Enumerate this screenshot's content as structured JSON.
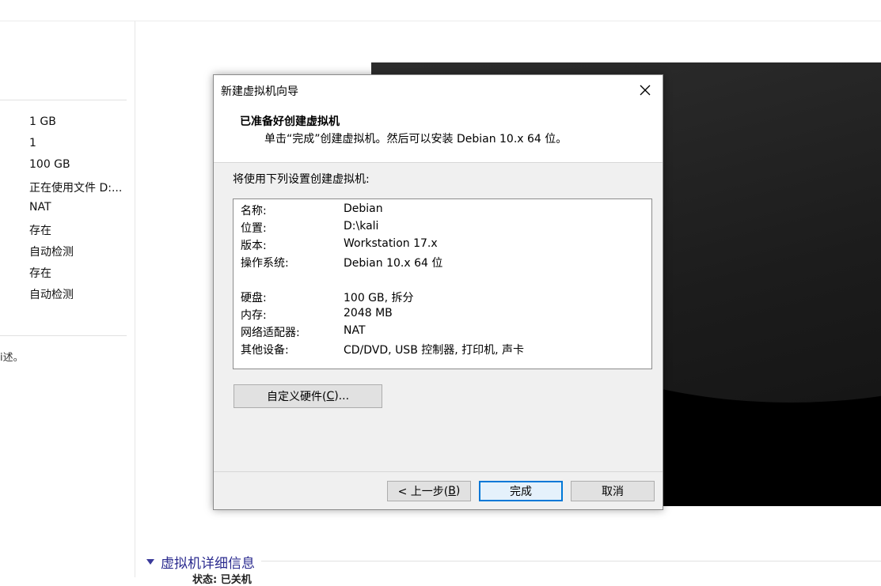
{
  "left_panel": {
    "hardware_values": [
      "1 GB",
      "1",
      "100 GB",
      "正在使用文件 D:...",
      "NAT",
      "存在",
      "自动检测",
      "存在",
      "自动检测"
    ],
    "description_fragment": "i述。"
  },
  "details_section": {
    "title": "虚拟机详细信息",
    "cut_text": "状态: 已关机"
  },
  "dialog": {
    "title": "新建虚拟机向导",
    "heading": "已准备好创建虚拟机",
    "subheading": "单击“完成”创建虚拟机。然后可以安装 Debian 10.x 64 位。",
    "intro": "将使用下列设置创建虚拟机:",
    "summary": [
      {
        "label": "名称:",
        "value": "Debian"
      },
      {
        "label": "位置:",
        "value": "D:\\kali"
      },
      {
        "label": "版本:",
        "value": "Workstation 17.x"
      },
      {
        "label": "操作系统:",
        "value": "Debian 10.x 64 位"
      },
      {
        "label": "硬盘:",
        "value": "100 GB, 拆分"
      },
      {
        "label": "内存:",
        "value": "2048 MB"
      },
      {
        "label": "网络适配器:",
        "value": "NAT"
      },
      {
        "label": "其他设备:",
        "value": "CD/DVD, USB 控制器, 打印机, 声卡"
      }
    ],
    "customize_button": {
      "prefix": "自定义硬件(",
      "mnemonic": "C",
      "suffix": ")..."
    },
    "back_button": {
      "prefix": "< 上一步(",
      "mnemonic": "B",
      "suffix": ")"
    },
    "finish_label": "完成",
    "cancel_label": "取消"
  },
  "colors": {
    "accent": "#0078d7",
    "link_title": "#2b2b8f"
  }
}
